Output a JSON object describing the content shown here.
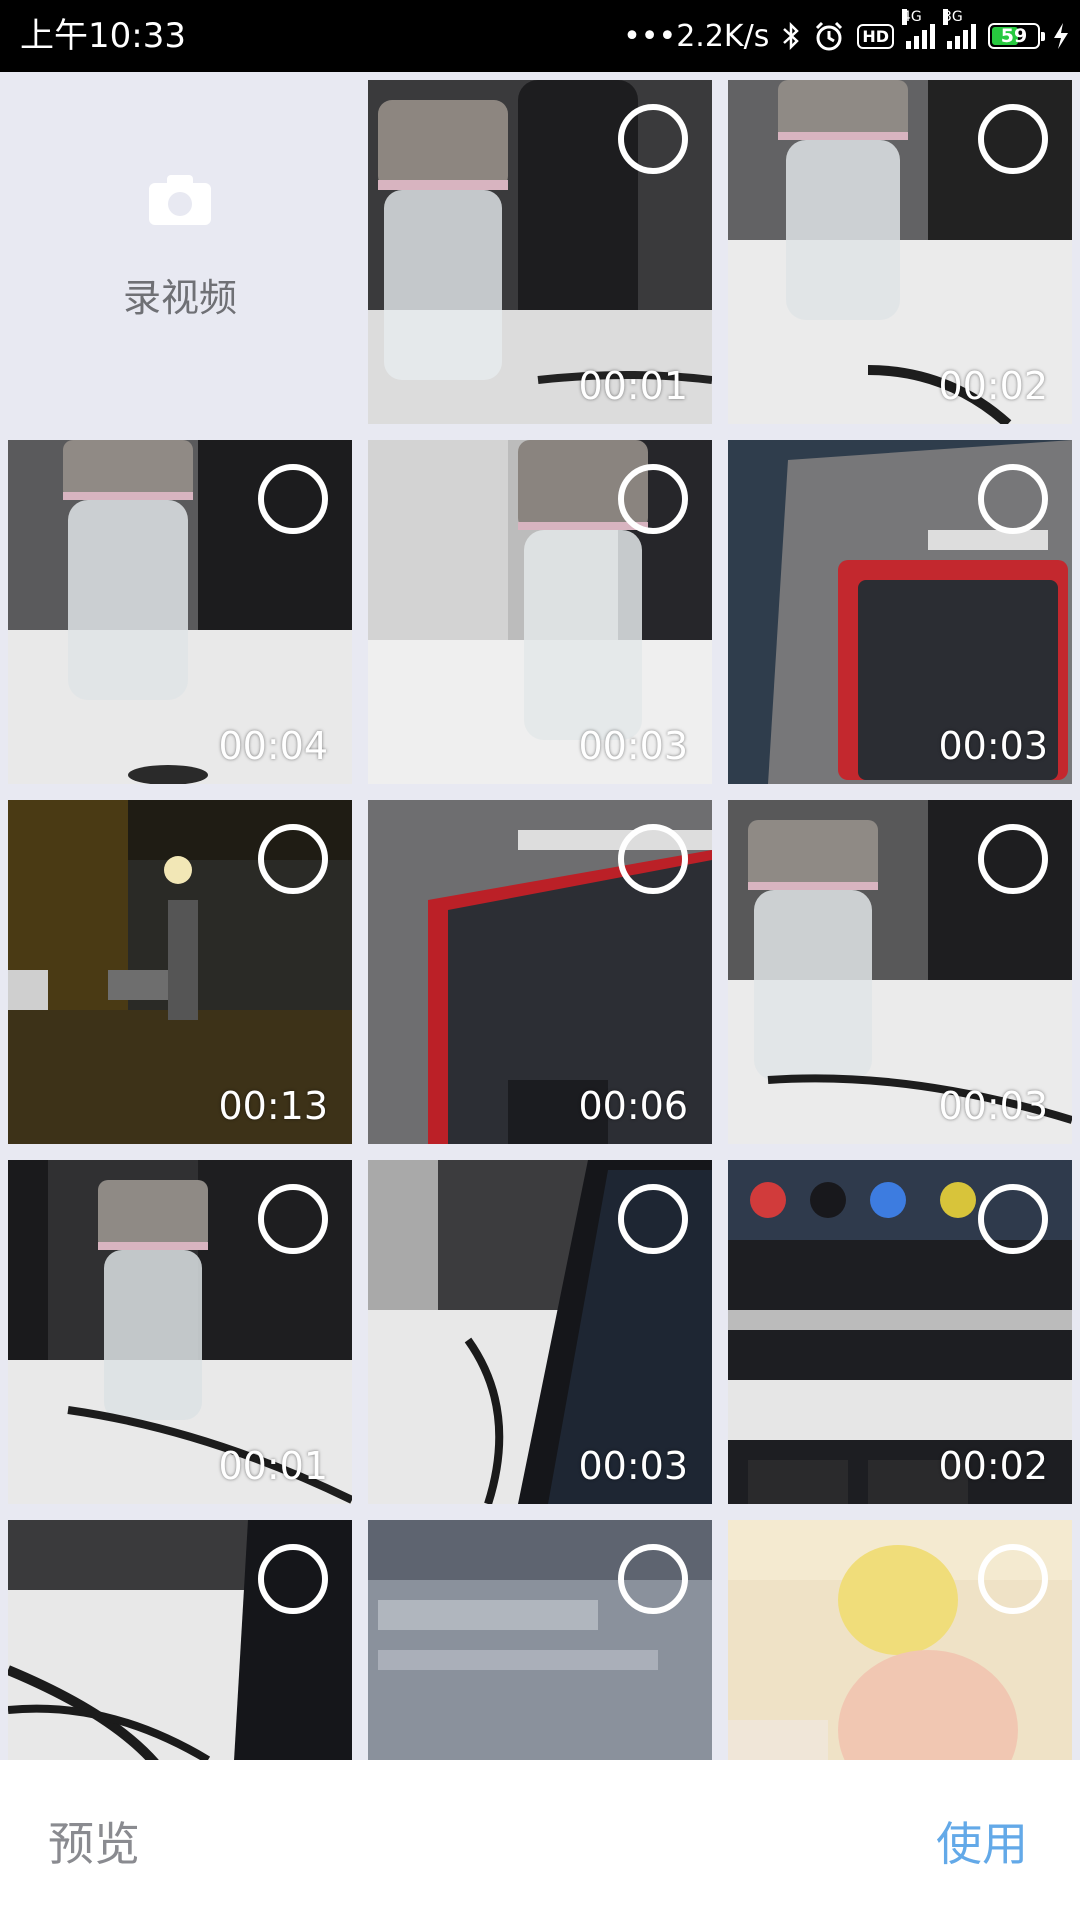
{
  "status_bar": {
    "time": "上午10:33",
    "network_speed": "2.2K/s",
    "hd_label": "HD",
    "signal_1_label": "4G",
    "signal_2_label": "3G",
    "battery_level": "59",
    "battery_fraction": 0.59,
    "icons": [
      "more-dots-icon",
      "bluetooth-icon",
      "alarm-icon",
      "hd-icon",
      "signal-4g-icon",
      "signal-3g-icon",
      "battery-icon",
      "charging-icon"
    ]
  },
  "camera_tile": {
    "label": "录视频",
    "icon": "camera-icon"
  },
  "videos": [
    {
      "duration": "00:01",
      "scene": "bottle-lid"
    },
    {
      "duration": "00:02",
      "scene": "bottle-cable"
    },
    {
      "duration": "00:04",
      "scene": "bottle-wall"
    },
    {
      "duration": "00:03",
      "scene": "bottle-close"
    },
    {
      "duration": "00:03",
      "scene": "red-device-partition"
    },
    {
      "duration": "00:13",
      "scene": "rainy-street"
    },
    {
      "duration": "00:06",
      "scene": "red-device"
    },
    {
      "duration": "00:03",
      "scene": "bottle-cable-2"
    },
    {
      "duration": "00:01",
      "scene": "bottle-dark"
    },
    {
      "duration": "00:03",
      "scene": "laptop-code"
    },
    {
      "duration": "00:02",
      "scene": "taskbar-monitor"
    },
    {
      "duration": "",
      "scene": "cables-laptop"
    },
    {
      "duration": "",
      "scene": "laptop-screen"
    },
    {
      "duration": "",
      "scene": "baby"
    }
  ],
  "bottom_bar": {
    "preview_label": "预览",
    "use_label": "使用"
  },
  "colors": {
    "background": "#e8e9f2",
    "accent": "#63a9e8",
    "battery": "#27c93f"
  }
}
